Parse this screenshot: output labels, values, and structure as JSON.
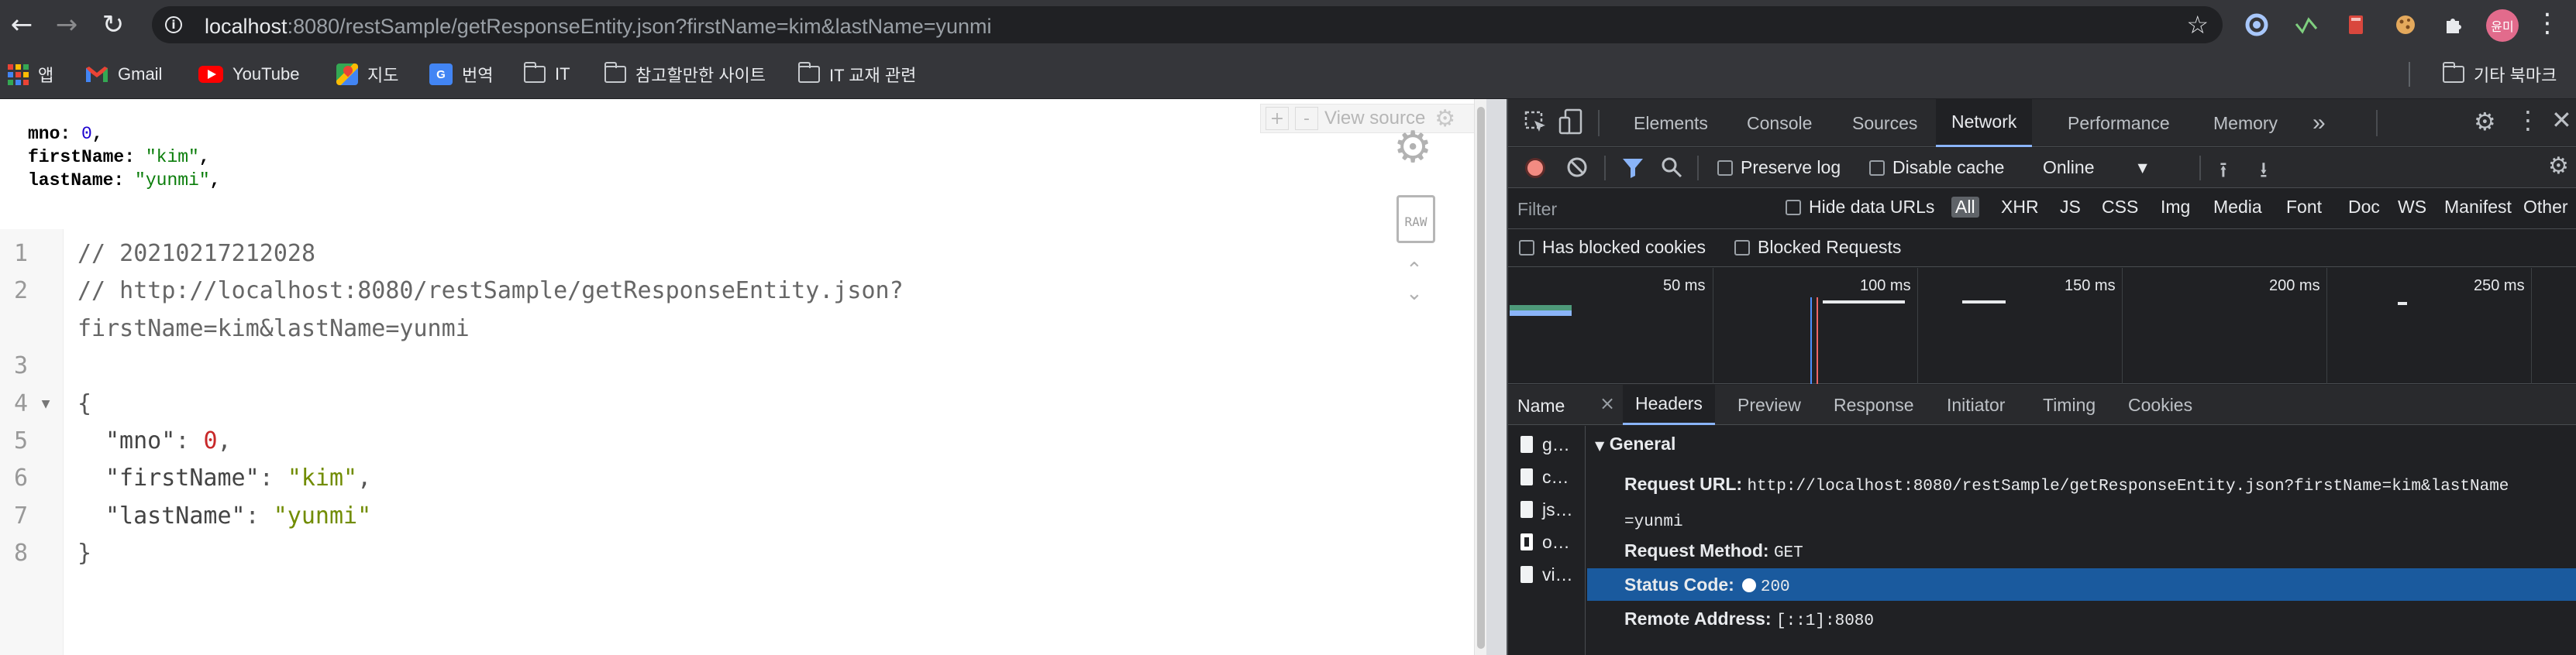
{
  "toolbar": {
    "back_icon": "←",
    "forward_icon": "→",
    "reload_icon": "↻",
    "url_host": "localhost",
    "url_rest": ":8080/restSample/getResponseEntity.json?firstName=kim&lastName=yunmi",
    "star_icon": "☆",
    "avatar_text": "윤미"
  },
  "bookmarks": {
    "items": [
      {
        "label": "앱"
      },
      {
        "label": "Gmail"
      },
      {
        "label": "YouTube"
      },
      {
        "label": "지도"
      },
      {
        "label": "번역"
      },
      {
        "label": "IT"
      },
      {
        "label": "참고할만한 사이트"
      },
      {
        "label": "IT 교재 관련"
      }
    ],
    "other": "기타 북마크",
    "translate_glyph": "G"
  },
  "viewer": {
    "raw": {
      "mno_key": "mno",
      "mno_val": "0",
      "firstName_key": "firstName",
      "firstName_val": "\"kim\"",
      "lastName_key": "lastName",
      "lastName_val": "\"yunmi\""
    },
    "view_source": "View source",
    "plus": "+",
    "minus": "-",
    "raw_badge": "RAW",
    "lines": [
      {
        "n": "1",
        "text": "// 20210217212028"
      },
      {
        "n": "2",
        "text": "// http://localhost:8080/restSample/getResponseEntity.json?"
      },
      {
        "n": "",
        "text": "firstName=kim&lastName=yunmi"
      },
      {
        "n": "3",
        "text": ""
      },
      {
        "n": "4",
        "text": "{"
      },
      {
        "n": "5",
        "key": "\"mno\"",
        "val": "0",
        "type": "num"
      },
      {
        "n": "6",
        "key": "\"firstName\"",
        "val": "\"kim\"",
        "type": "str"
      },
      {
        "n": "7",
        "key": "\"lastName\"",
        "val": "\"yunmi\"",
        "type": "str",
        "last": true
      },
      {
        "n": "8",
        "text": "}"
      }
    ]
  },
  "devtools": {
    "tabs": [
      "Elements",
      "Console",
      "Sources",
      "Network",
      "Performance",
      "Memory"
    ],
    "active_tab": "Network",
    "more_icon": "»",
    "network_bar": {
      "preserve_log": "Preserve log",
      "disable_cache": "Disable cache",
      "throttle": "Online"
    },
    "filter": {
      "placeholder": "Filter",
      "hide_data_urls": "Hide data URLs",
      "types": [
        "All",
        "XHR",
        "JS",
        "CSS",
        "Img",
        "Media",
        "Font",
        "Doc",
        "WS",
        "Manifest",
        "Other"
      ],
      "has_blocked_cookies": "Has blocked cookies",
      "blocked_requests": "Blocked Requests"
    },
    "timeline_labels": [
      "50 ms",
      "100 ms",
      "150 ms",
      "200 ms",
      "250 ms"
    ],
    "request_header": {
      "name": "Name",
      "close": "×",
      "tabs": [
        "Headers",
        "Preview",
        "Response",
        "Initiator",
        "Timing",
        "Cookies"
      ]
    },
    "requests": [
      "g…",
      "c…",
      "js…",
      "o…",
      "vi…"
    ],
    "general": {
      "title": "General",
      "request_url_key": "Request URL:",
      "request_url_val": "http://localhost:8080/restSample/getResponseEntity.json?firstName=kim&lastName",
      "request_url_val2": "=yunmi",
      "request_method_key": "Request Method:",
      "request_method_val": "GET",
      "status_code_key": "Status Code:",
      "status_code_val": "200",
      "remote_address_key": "Remote Address:",
      "remote_address_val": "[::1]:8080"
    }
  }
}
